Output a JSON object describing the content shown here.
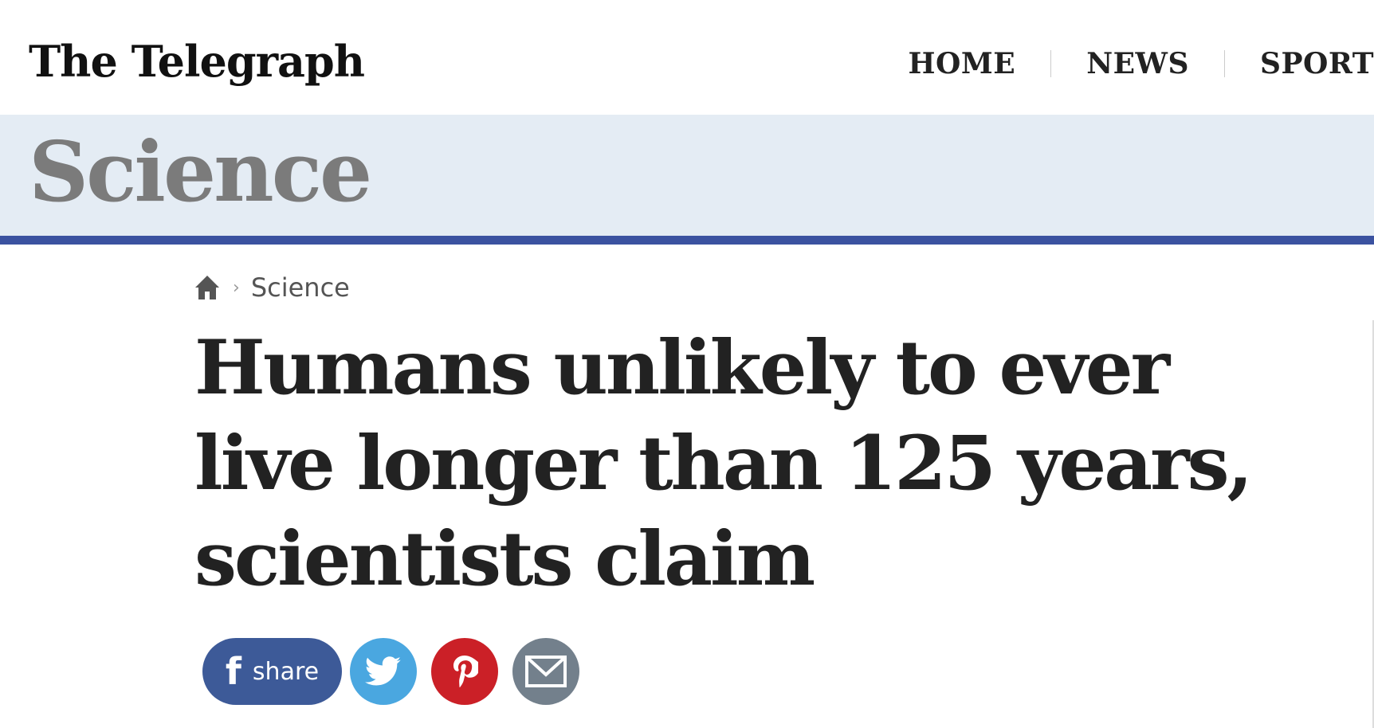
{
  "masthead": {
    "logo_text": "The Telegraph",
    "nav": [
      {
        "label": "HOME"
      },
      {
        "label": "NEWS"
      },
      {
        "label": "SPORT"
      }
    ]
  },
  "section": {
    "title": "Science",
    "accent_color": "#3b52a0",
    "band_color": "#e4ecf4"
  },
  "breadcrumb": {
    "home_icon": "home-icon",
    "separator": "›",
    "current": "Science"
  },
  "article": {
    "headline": "Humans unlikely to ever live longer than 125 years, scientists claim"
  },
  "share": {
    "facebook_glyph": "f",
    "facebook_label": "share",
    "facebook_color": "#3d5a98",
    "twitter_icon": "twitter-icon",
    "twitter_color": "#4aa7e0",
    "pinterest_icon": "pinterest-icon",
    "pinterest_color": "#cb2027",
    "email_icon": "envelope-icon",
    "email_color": "#73808c"
  }
}
